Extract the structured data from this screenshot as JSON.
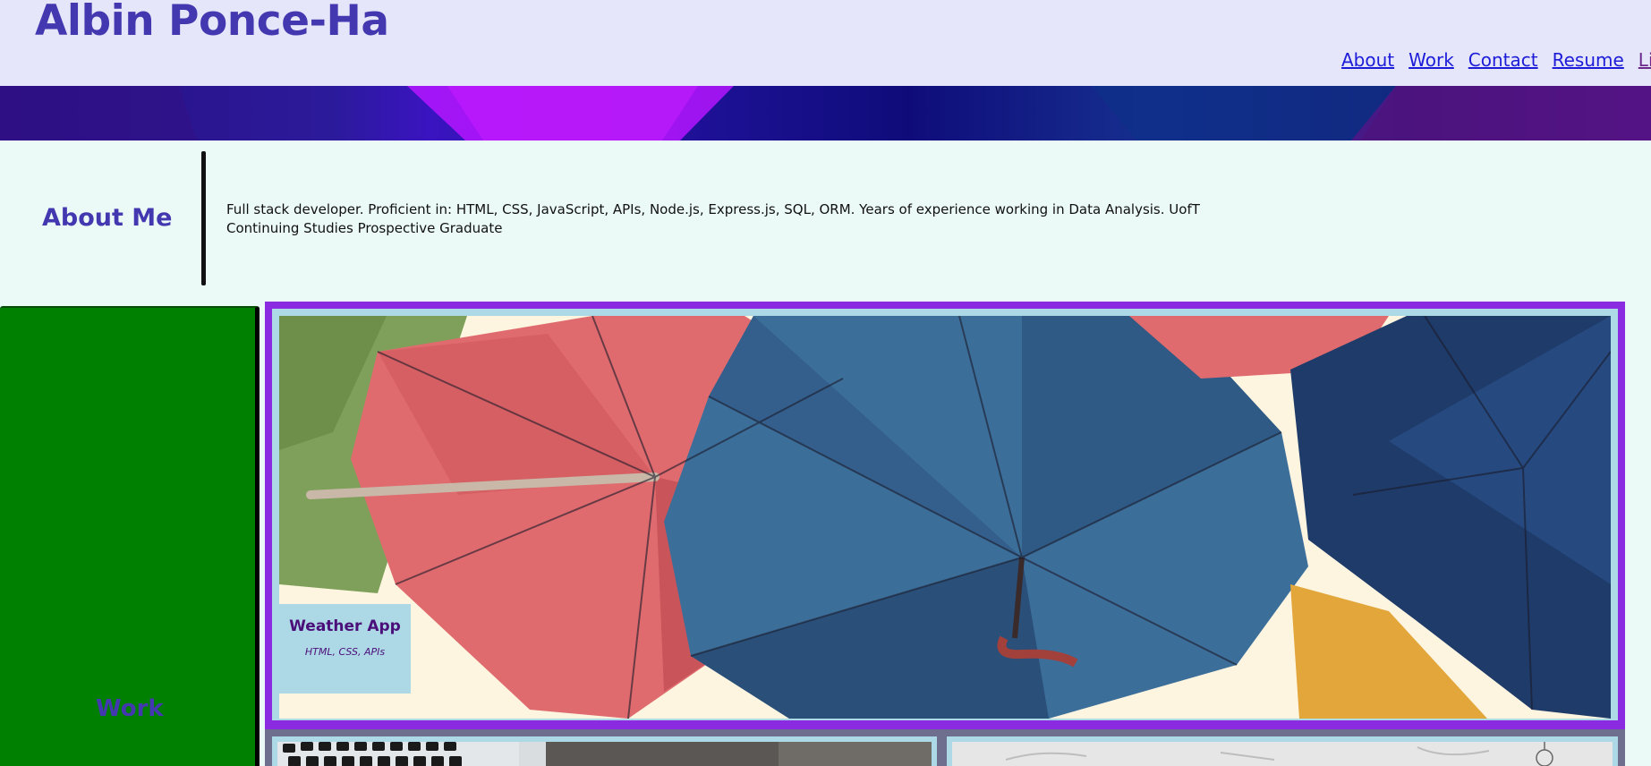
{
  "header": {
    "title": "Albin Ponce-Ha",
    "nav": [
      {
        "label": "About"
      },
      {
        "label": "Work"
      },
      {
        "label": "Contact"
      },
      {
        "label": "Resume"
      },
      {
        "label": "Linke"
      }
    ]
  },
  "about": {
    "heading": "About Me",
    "text": "Full stack developer. Proficient in: HTML, CSS, JavaScript, APIs, Node.js, Express.js, SQL, ORM. Years of experience working in Data Analysis. UofT Continuing Studies Prospective Graduate"
  },
  "work": {
    "heading": "Work",
    "featured": {
      "title": "Weather App",
      "subtitle": "HTML, CSS, APIs",
      "image": "umbrellas-photo"
    },
    "cards": [
      {
        "image": "laptop-keyboard-photo"
      },
      {
        "image": "sketch-paper-photo"
      }
    ]
  },
  "colors": {
    "header_bg": "#e6e6fa",
    "title": "#4338b0",
    "page_bg": "#ebfaf7",
    "sidebar": "#008000",
    "featured_border": "#8a2be2",
    "card_border": "#add8e6",
    "link": "#1c1cd8"
  }
}
